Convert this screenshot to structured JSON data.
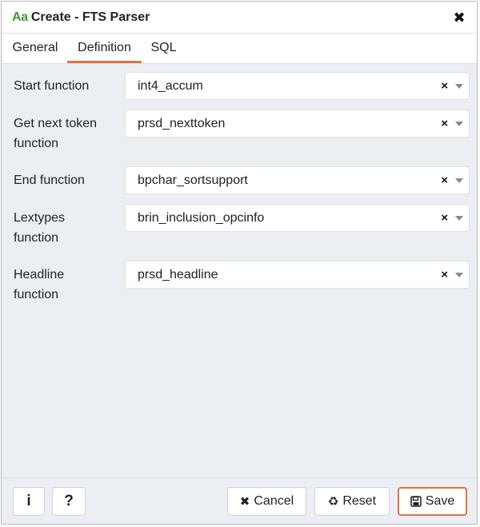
{
  "window": {
    "title": "Create - FTS Parser",
    "title_icon": "Aa",
    "close_glyph": "✖"
  },
  "tabs": [
    {
      "label": "General",
      "active": false
    },
    {
      "label": "Definition",
      "active": true
    },
    {
      "label": "SQL",
      "active": false
    }
  ],
  "fields": [
    {
      "label": "Start function",
      "value": "int4_accum"
    },
    {
      "label": "Get next token function",
      "value": "prsd_nexttoken"
    },
    {
      "label": "End function",
      "value": "bpchar_sortsupport"
    },
    {
      "label": "Lextypes function",
      "value": "brin_inclusion_opcinfo"
    },
    {
      "label": "Headline function",
      "value": "prsd_headline"
    }
  ],
  "select_clear_glyph": "×",
  "footer": {
    "info_glyph": "i",
    "help_glyph": "?",
    "cancel_label": "Cancel",
    "reset_label": "Reset",
    "save_label": "Save"
  },
  "colors": {
    "accent": "#e0763a",
    "title_icon": "#3f9b2f",
    "panel_bg": "#ebeef3"
  }
}
